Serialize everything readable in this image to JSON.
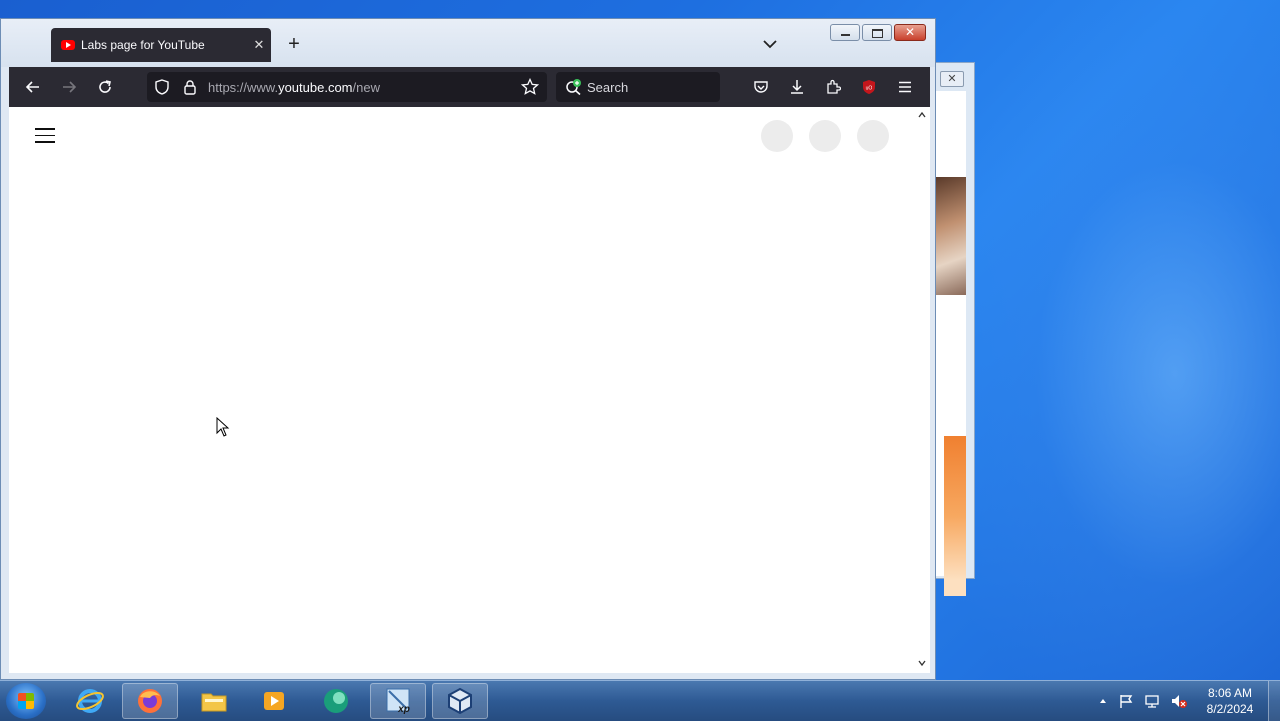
{
  "browser": {
    "tab": {
      "title": "Labs page for YouTube",
      "close_label": "✕",
      "favicon": "youtube-icon"
    },
    "new_tab_label": "+",
    "address": {
      "prefix": "https://www.",
      "domain": "youtube.com",
      "path": "/new"
    },
    "search": {
      "placeholder": "Search"
    }
  },
  "window_controls": {
    "minimize": "minimize-icon",
    "maximize": "maximize-icon",
    "close": "✕"
  },
  "page": {
    "menu_icon": "hamburger-menu-icon",
    "loading_placeholders": 3
  },
  "background_window": {
    "close_label": "✕"
  },
  "taskbar": {
    "items": [
      "start-orb",
      "internet-explorer-icon",
      "firefox-icon",
      "file-explorer-icon",
      "media-player-icon",
      "app-icon",
      "windows-xp-mode-icon",
      "virtualbox-icon"
    ],
    "clock": {
      "time": "8:06 AM",
      "date": "8/2/2024"
    }
  },
  "colors": {
    "toolbar": "#2b2a33",
    "urlbar": "#1c1b22",
    "desktop": "#1e6fe0"
  }
}
